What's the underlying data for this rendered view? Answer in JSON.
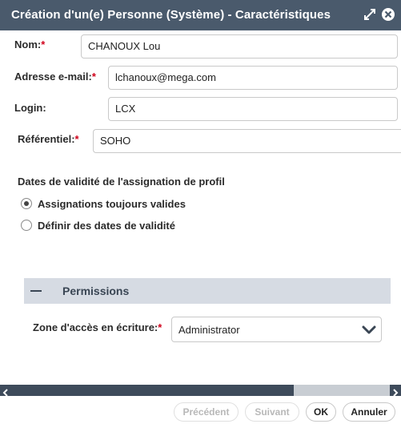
{
  "window": {
    "title": "Création d'un(e) Personne (Système) - Caractéristiques"
  },
  "form": {
    "nom": {
      "label": "Nom:",
      "required_mark": "*",
      "value": "CHANOUX Lou"
    },
    "email": {
      "label": "Adresse e-mail:",
      "required_mark": "*",
      "value": "lchanoux@mega.com"
    },
    "login": {
      "label": "Login:",
      "value": "LCX"
    },
    "referentiel": {
      "label": "Référentiel:",
      "required_mark": "*",
      "value": "SOHO"
    }
  },
  "validity": {
    "heading": "Dates de validité de l'assignation de profil",
    "options": [
      {
        "label": "Assignations toujours valides",
        "selected": true
      },
      {
        "label": "Définir des dates de validité",
        "selected": false
      }
    ]
  },
  "permissions": {
    "title": "Permissions",
    "zone_label": "Zone d'accès en écriture:",
    "zone_required_mark": "*",
    "zone_value": "Administrator"
  },
  "footer": {
    "prev": "Précédent",
    "next": "Suivant",
    "ok": "OK",
    "cancel": "Annuler"
  },
  "colors": {
    "titlebar": "#4a5a6c",
    "required": "#d0021b",
    "section_header": "#d6dbe3"
  }
}
